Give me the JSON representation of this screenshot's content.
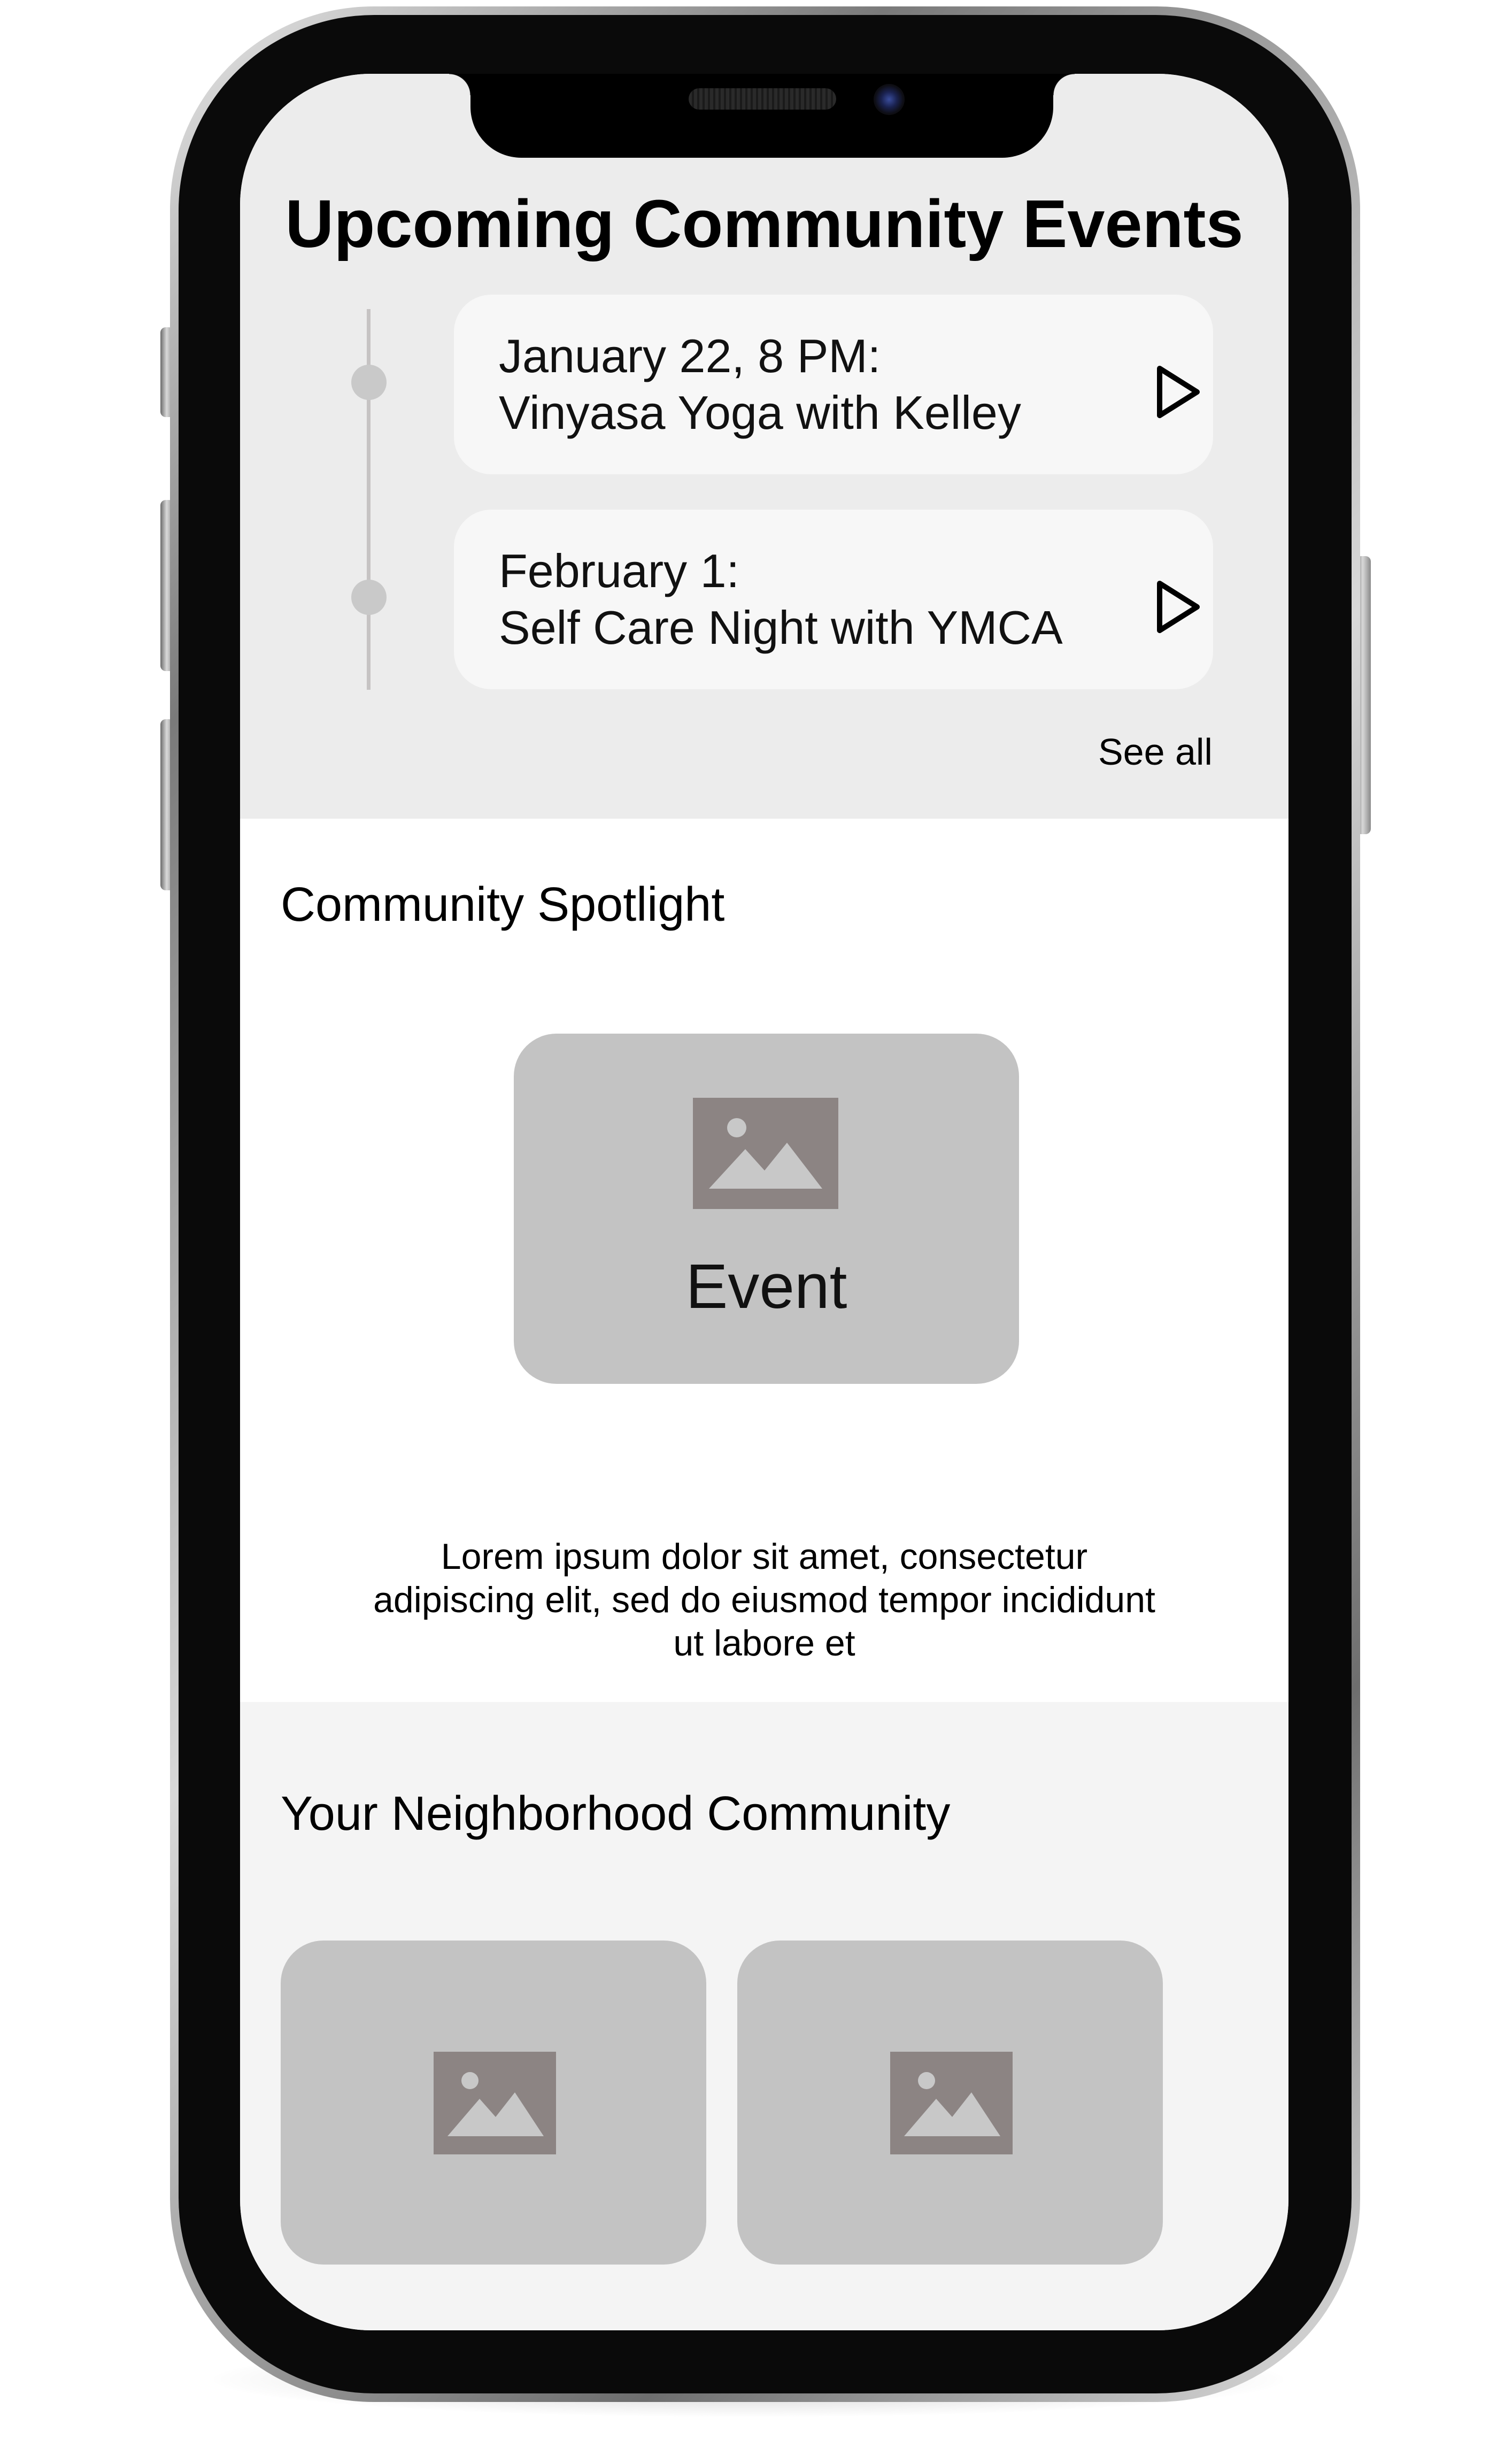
{
  "events": {
    "title": "Upcoming Community Events",
    "items": [
      {
        "line1": "January 22, 8 PM:",
        "line2": "Vinyasa Yoga with Kelley"
      },
      {
        "line1": "February 1:",
        "line2": "Self Care Night with YMCA"
      }
    ],
    "see_all": "See all"
  },
  "spotlight": {
    "heading": "Community Spotlight",
    "card_label": "Event",
    "description_lines": [
      "Lorem ipsum dolor sit amet, consectetur",
      "adipiscing elit, sed do eiusmod tempor incididunt",
      "ut labore et"
    ]
  },
  "neighborhood": {
    "heading": "Your Neighborhood Community"
  },
  "icons": {
    "event_arrow": "play-triangle-icon",
    "placeholder": "image-placeholder-icon"
  },
  "colors": {
    "events_bg": "#ececec",
    "card_bg": "#f7f7f7",
    "placeholder_bg": "#c3c3c3",
    "placeholder_icon": "#8c8483"
  }
}
